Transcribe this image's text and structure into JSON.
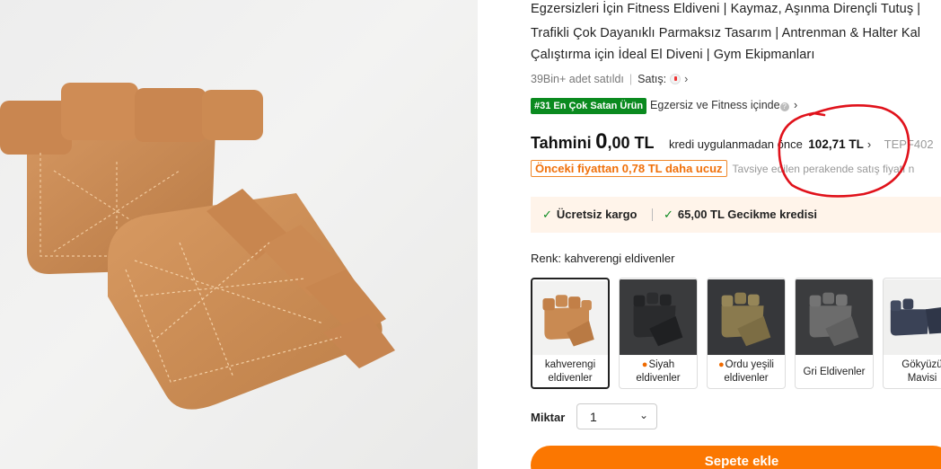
{
  "product": {
    "title_lines": [
      "Egzersizleri İçin Fitness Eldiveni | Kaymaz, Aşınma Dirençli Tutuş |",
      "Trafikli Çok Dayanıklı Parmaksız Tasarım | Antrenman & Halter Kal",
      "Çalıştırma için İdeal El Diveni | Gym Ekipmanları"
    ],
    "sold": "39Bin+ adet satıldı",
    "seller_label": "Satış:",
    "rank_badge": "#31 En Çok Satan Ürün",
    "rank_category": "Egzersiz ve Fitness içinde"
  },
  "price": {
    "label": "Tahmini",
    "integer": "0",
    "decimal": ",00 TL",
    "note": "kredi uygulanmadan önce",
    "old_price": "102,71 TL",
    "code": "TEPF402",
    "discount_badge": "Önceki fiyattan 0,78 TL daha ucuz",
    "discount_note": "Tavsiye edilen perakende satış fiyatı n"
  },
  "shipping": {
    "free": "Ücretsiz kargo",
    "credit": "65,00 TL Gecikme kredisi"
  },
  "variants": {
    "label": "Renk: kahverengi eldivenler",
    "items": [
      {
        "line1": "kahverengi",
        "line2": "eldivenler",
        "hot": false,
        "color": "#c98a52"
      },
      {
        "line1": "Siyah",
        "line2": "eldivenler",
        "hot": true,
        "color": "#2e2f31"
      },
      {
        "line1": "Ordu yeşili",
        "line2": "eldivenler",
        "hot": true,
        "color": "#8a7a4e"
      },
      {
        "line1": "Gri Eldivenler",
        "line2": "",
        "hot": false,
        "color": "#6c6c6c"
      },
      {
        "line1": "Gökyüzü",
        "line2": "Mavisi",
        "hot": false,
        "color": "#3a4256"
      }
    ]
  },
  "quantity": {
    "label": "Miktar",
    "value": "1"
  },
  "cta": {
    "add_to_cart": "Sepete ekle"
  },
  "colors": {
    "accent_orange": "#fb7701",
    "badge_green": "#0a8a1f",
    "annotation_red": "#e0121b"
  }
}
